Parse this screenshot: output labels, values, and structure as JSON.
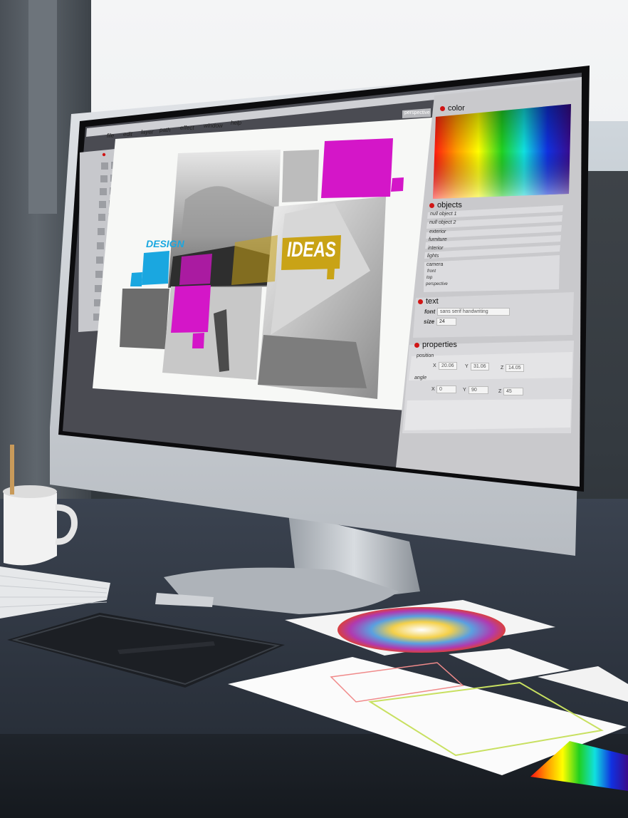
{
  "menu": {
    "items": [
      "file",
      "edit",
      "layer",
      "path",
      "effect",
      "window",
      "help"
    ],
    "perspective_button": "perspective"
  },
  "canvas": {
    "design_word": "DESIGN",
    "ideas_word": "IDEAS"
  },
  "panels": {
    "color": {
      "title": "color"
    },
    "objects": {
      "title": "objects",
      "items": [
        "null object 1",
        "null object 2",
        "exterior",
        "furniture",
        "interior",
        "lights",
        "camera",
        "front",
        "top",
        "perspective"
      ]
    },
    "text": {
      "title": "text",
      "font_label": "font",
      "font_value": "sans serif handwriting",
      "size_label": "size",
      "size_value": "24"
    },
    "properties": {
      "title": "properties",
      "position_label": "position",
      "position": {
        "x_label": "X",
        "x": "20.06",
        "y_label": "Y",
        "y": "31.06",
        "z_label": "Z",
        "z": "14.05"
      },
      "angle_label": "angle",
      "angle": {
        "x_label": "X",
        "x": "0",
        "y_label": "Y",
        "y": "90",
        "z_label": "Z",
        "z": "45"
      }
    }
  },
  "colors": {
    "accent_cyan": "#1aa7e0",
    "accent_magenta": "#d416c8",
    "accent_gold": "#c9a316",
    "record_dot": "#d01515"
  }
}
